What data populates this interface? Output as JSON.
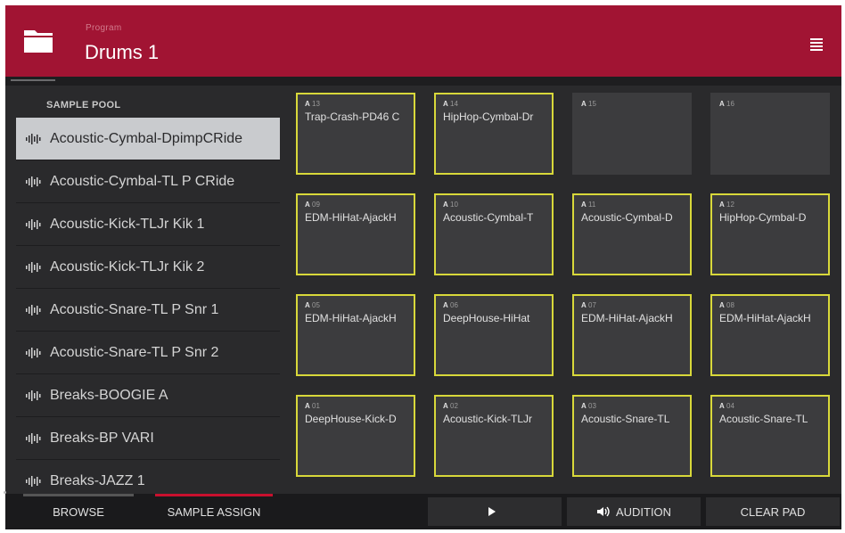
{
  "header": {
    "label": "Program",
    "title": "Drums 1"
  },
  "pool": {
    "title": "SAMPLE POOL",
    "items": [
      {
        "label": "Acoustic-Cymbal-DpimpCRide",
        "selected": true
      },
      {
        "label": "Acoustic-Cymbal-TL P CRide"
      },
      {
        "label": "Acoustic-Kick-TLJr Kik 1"
      },
      {
        "label": "Acoustic-Kick-TLJr Kik 2"
      },
      {
        "label": "Acoustic-Snare-TL P Snr 1"
      },
      {
        "label": "Acoustic-Snare-TL P Snr 2"
      },
      {
        "label": "Breaks-BOOGIE A"
      },
      {
        "label": "Breaks-BP VARI"
      },
      {
        "label": "Breaks-JAZZ 1"
      }
    ]
  },
  "pads": [
    {
      "bank": "A",
      "num": "13",
      "name": "Trap-Crash-PD46 C"
    },
    {
      "bank": "A",
      "num": "14",
      "name": "HipHop-Cymbal-Dr"
    },
    {
      "bank": "A",
      "num": "15",
      "name": ""
    },
    {
      "bank": "A",
      "num": "16",
      "name": ""
    },
    {
      "bank": "A",
      "num": "09",
      "name": "EDM-HiHat-AjackH"
    },
    {
      "bank": "A",
      "num": "10",
      "name": "Acoustic-Cymbal-T"
    },
    {
      "bank": "A",
      "num": "11",
      "name": "Acoustic-Cymbal-D"
    },
    {
      "bank": "A",
      "num": "12",
      "name": "HipHop-Cymbal-D"
    },
    {
      "bank": "A",
      "num": "05",
      "name": "EDM-HiHat-AjackH"
    },
    {
      "bank": "A",
      "num": "06",
      "name": "DeepHouse-HiHat"
    },
    {
      "bank": "A",
      "num": "07",
      "name": "EDM-HiHat-AjackH"
    },
    {
      "bank": "A",
      "num": "08",
      "name": "EDM-HiHat-AjackH"
    },
    {
      "bank": "A",
      "num": "01",
      "name": "DeepHouse-Kick-D"
    },
    {
      "bank": "A",
      "num": "02",
      "name": "Acoustic-Kick-TLJr"
    },
    {
      "bank": "A",
      "num": "03",
      "name": "Acoustic-Snare-TL"
    },
    {
      "bank": "A",
      "num": "04",
      "name": "Acoustic-Snare-TL"
    }
  ],
  "bottom": {
    "browse": "BROWSE",
    "sample_assign": "SAMPLE ASSIGN",
    "play_icon": "play-icon",
    "audition": "AUDITION",
    "clear_pad": "CLEAR PAD"
  },
  "colors": {
    "header": "#a11433",
    "pad_border": "#d8d83a",
    "active_tab": "#c8102e",
    "selected_row": "#c9cbce"
  }
}
